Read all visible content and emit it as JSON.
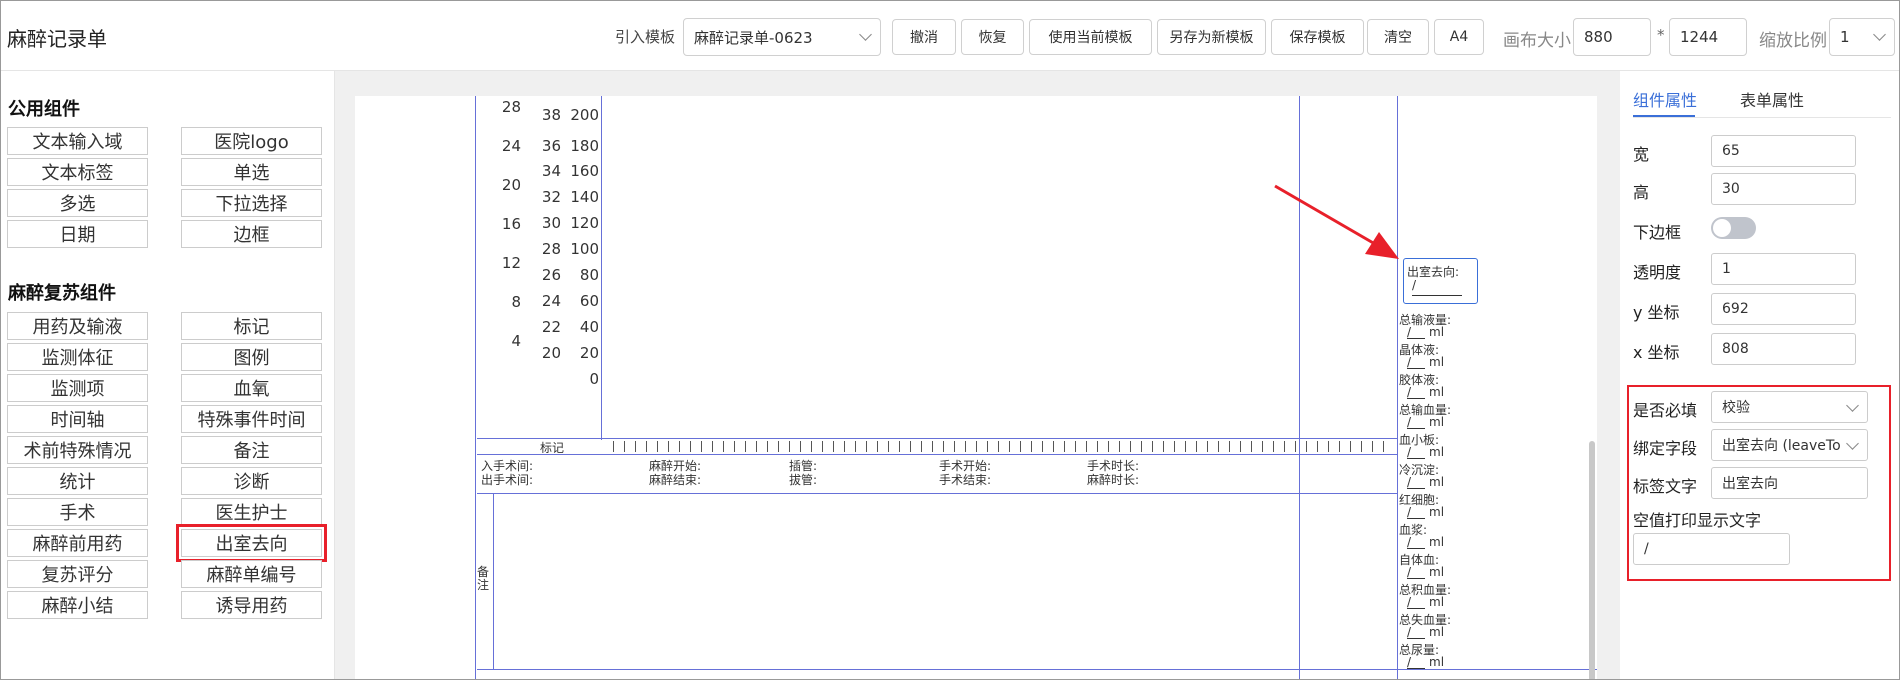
{
  "header": {
    "title": "麻醉记录单",
    "import_label": "引入模板",
    "template_select": "麻醉记录单-0623",
    "buttons": [
      "撤消",
      "恢复",
      "使用当前模板",
      "另存为新模板",
      "保存模板",
      "清空",
      "A4"
    ],
    "canvas_size_label": "画布大小",
    "canvas_width": "880",
    "times": "*",
    "canvas_height": "1244",
    "zoom_label": "缩放比例",
    "zoom_value": "1"
  },
  "left": {
    "section1": "公用组件",
    "section1_items": [
      "文本输入域",
      "医院logo",
      "文本标签",
      "单选",
      "多选",
      "下拉选择",
      "日期",
      "边框"
    ],
    "section2": "麻醉复苏组件",
    "section2_items": [
      "用药及输液",
      "标记",
      "监测体征",
      "图例",
      "监测项",
      "血氧",
      "时间轴",
      "特殊事件时间",
      "术前特殊情况",
      "备注",
      "统计",
      "诊断",
      "手术",
      "医生护士",
      "麻醉前用药",
      "出室去向",
      "复苏评分",
      "麻醉单编号",
      "麻醉小结",
      "诱导用药"
    ]
  },
  "form": {
    "axis_col1": [
      "28",
      "24",
      "20",
      "16",
      "12",
      "8",
      "4"
    ],
    "axis_col2": [
      "38",
      "36",
      "34",
      "32",
      "30",
      "28",
      "26",
      "24",
      "22",
      "20"
    ],
    "axis_col3": [
      "200",
      "180",
      "160",
      "140",
      "120",
      "100",
      "80",
      "60",
      "40",
      "20",
      "0"
    ],
    "mark_label": "标记",
    "time_row1": [
      "入手术间:",
      "麻醉开始:",
      "插管:",
      "手术开始:",
      "手术时长:"
    ],
    "time_row2": [
      "出手术间:",
      "麻醉结束:",
      "拔管:",
      "手术结束:",
      "麻醉时长:"
    ],
    "remark_label": "备注",
    "exit_label": "出室去向:",
    "exit_value": "/",
    "stats": [
      "总输液量:",
      "晶体液:",
      "胶体液:",
      "总输血量:",
      "血小板:",
      "冷沉淀:",
      "红细胞:",
      "血浆:",
      "自体血:",
      "总积血量:",
      "总失血量:",
      "总尿量:"
    ],
    "stat_value": "/",
    "unit": "ml"
  },
  "right": {
    "tabs": [
      "组件属性",
      "表单属性"
    ],
    "props": [
      {
        "label": "宽",
        "value": "65"
      },
      {
        "label": "高",
        "value": "30"
      }
    ],
    "bottom_border_label": "下边框",
    "props2": [
      {
        "label": "透明度",
        "value": "1"
      },
      {
        "label": "y 坐标",
        "value": "692"
      },
      {
        "label": "x 坐标",
        "value": "808"
      }
    ],
    "required_label": "是否必填",
    "required_value": "校验",
    "bind_label": "绑定字段",
    "bind_value": "出室去向 (leaveTo",
    "tag_label": "标签文字",
    "tag_value": "出室去向",
    "empty_label": "空值打印显示文字",
    "empty_value": "/"
  },
  "colors": {
    "accent": "#3a6fd8",
    "highlight": "#e8202a",
    "border": "#6670d8"
  }
}
